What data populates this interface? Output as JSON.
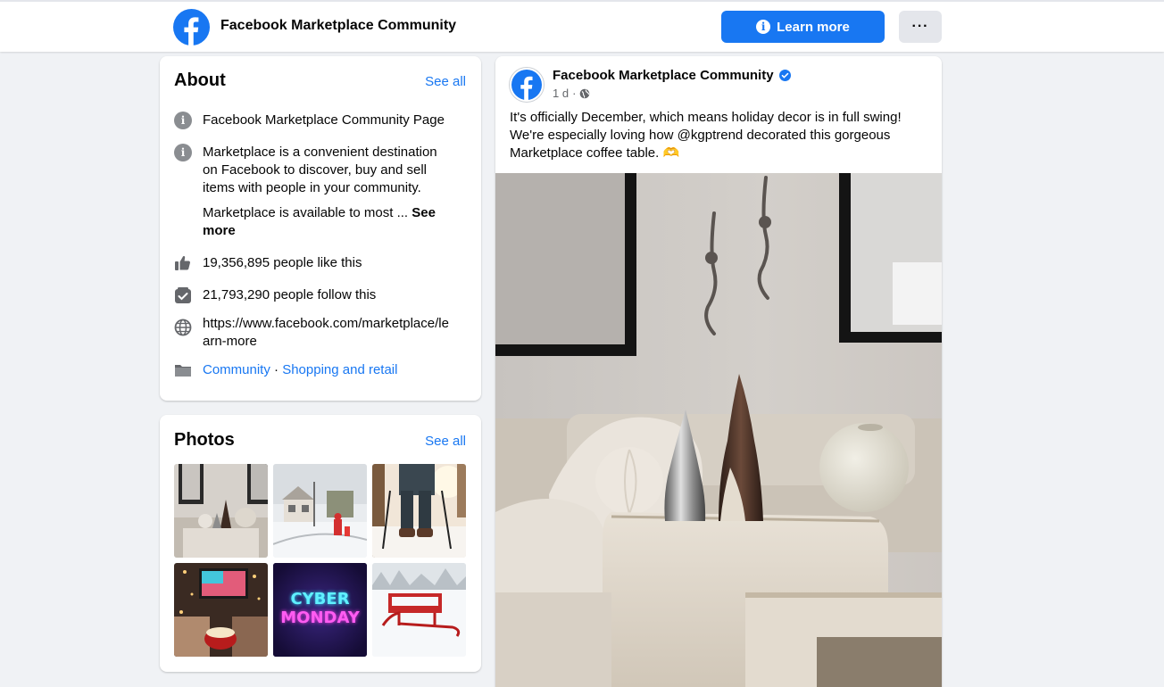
{
  "header": {
    "page_name": "Facebook Marketplace Community",
    "learn_more_label": "Learn more",
    "more_label": "···"
  },
  "about": {
    "title": "About",
    "see_all": "See all",
    "category_line": "Facebook Marketplace Community Page",
    "description": "Marketplace is a convenient destination on Facebook to discover, buy and sell items with people in your community.",
    "description_more": "Marketplace is available to most ...",
    "see_more": "See more",
    "likes": "19,356,895 people like this",
    "follows": "21,793,290 people follow this",
    "website": "https://www.facebook.com/marketplace/learn-more",
    "category_1": "Community",
    "category_sep": " · ",
    "category_2": "Shopping and retail"
  },
  "photos": {
    "title": "Photos",
    "see_all": "See all",
    "cyber_line1": "CYBER",
    "cyber_line2": "MONDAY"
  },
  "post": {
    "author": "Facebook Marketplace Community",
    "time": "1 d",
    "meta_sep": "·",
    "text": "It's officially December, which means holiday decor is in full swing! We're especially loving how @kgptrend decorated this gorgeous Marketplace coffee table. 🫶"
  },
  "colors": {
    "brand": "#1877f2",
    "background": "#f0f2f5"
  }
}
